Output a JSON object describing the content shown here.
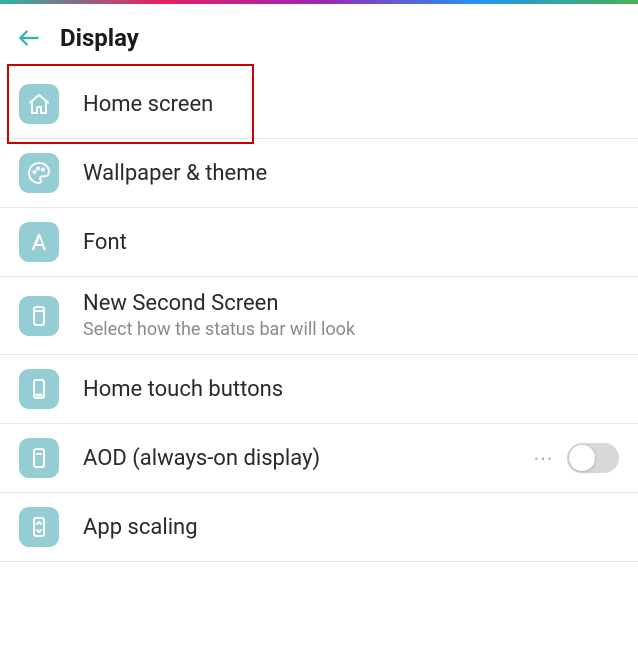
{
  "header": {
    "title": "Display"
  },
  "items": [
    {
      "icon": "home-icon",
      "label": "Home screen",
      "subtitle": null,
      "highlight": true
    },
    {
      "icon": "palette-icon",
      "label": "Wallpaper & theme",
      "subtitle": null
    },
    {
      "icon": "font-icon",
      "label": "Font",
      "subtitle": null
    },
    {
      "icon": "second-screen-icon",
      "label": "New Second Screen",
      "subtitle": "Select how the status bar will look"
    },
    {
      "icon": "touch-buttons-icon",
      "label": "Home touch buttons",
      "subtitle": null
    },
    {
      "icon": "aod-icon",
      "label": "AOD (always-on display)",
      "subtitle": null,
      "more": true,
      "toggle": false
    },
    {
      "icon": "scaling-icon",
      "label": "App scaling",
      "subtitle": null
    }
  ],
  "colors": {
    "accent": "#2db5a5",
    "iconBg": "#94cdd3",
    "highlightBorder": "#cc0000"
  }
}
